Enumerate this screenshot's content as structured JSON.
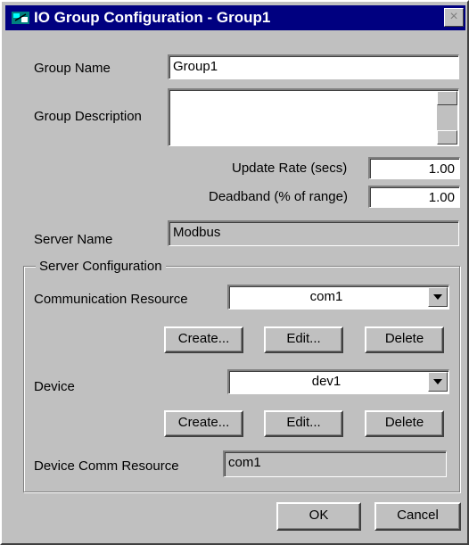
{
  "window": {
    "title": "IO Group Configuration - Group1",
    "close_label": "×"
  },
  "group_name": {
    "label": "Group Name",
    "value": "Group1"
  },
  "group_description": {
    "label": "Group Description",
    "value": ""
  },
  "update_rate": {
    "label": "Update Rate (secs)",
    "value": "1.00"
  },
  "deadband": {
    "label": "Deadband (% of range)",
    "value": "1.00"
  },
  "server_name": {
    "label": "Server Name",
    "value": "Modbus"
  },
  "server_config": {
    "legend": "Server Configuration",
    "comm_resource": {
      "label": "Communication Resource",
      "value": "com1"
    },
    "comm_buttons": {
      "create": "Create...",
      "edit": "Edit...",
      "delete": "Delete"
    },
    "device": {
      "label": "Device",
      "value": "dev1"
    },
    "device_buttons": {
      "create": "Create...",
      "edit": "Edit...",
      "delete": "Delete"
    },
    "device_comm_resource": {
      "label": "Device Comm Resource",
      "value": "com1"
    }
  },
  "actions": {
    "ok": "OK",
    "cancel": "Cancel"
  }
}
